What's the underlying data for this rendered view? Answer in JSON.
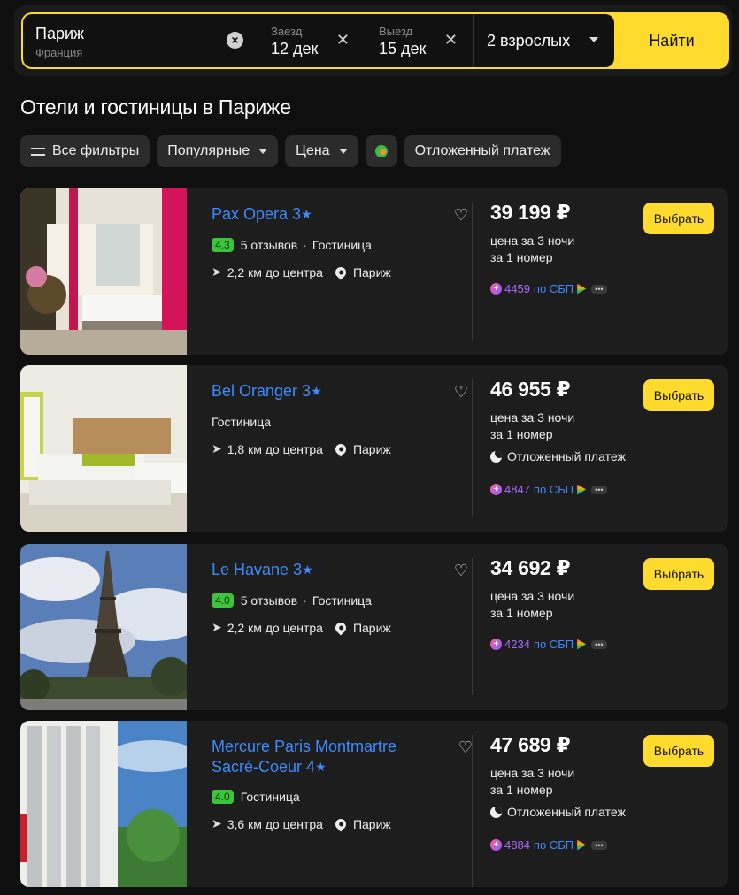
{
  "search": {
    "destination": "Париж",
    "destination_country": "Франция",
    "checkin_label": "Заезд",
    "checkin_value": "12 дек",
    "checkout_label": "Выезд",
    "checkout_value": "15 дек",
    "guests": "2 взрослых",
    "find_label": "Найти"
  },
  "page_title": "Отели и гостиницы в Париже",
  "filters": {
    "all_filters": "Все фильтры",
    "popular": "Популярные",
    "price": "Цена",
    "deferred": "Отложенный платеж"
  },
  "hotels": [
    {
      "name": "Pax Opera 3",
      "rating": "4.3",
      "reviews": "5 отзывов",
      "type": "Гостиница",
      "distance": "2,2 км до центра",
      "city": "Париж",
      "price": "39 199 ₽",
      "price_note_1": "цена за 3 ночи",
      "price_note_2": "за 1 номер",
      "deferred": "",
      "cashback": "4459",
      "cashback_suffix": "по СБП",
      "select": "Выбрать"
    },
    {
      "name": "Bel Oranger 3",
      "rating": "",
      "reviews": "",
      "type": "Гостиница",
      "distance": "1,8 км до центра",
      "city": "Париж",
      "price": "46 955 ₽",
      "price_note_1": "цена за 3 ночи",
      "price_note_2": "за 1 номер",
      "deferred": "Отложенный платеж",
      "cashback": "4847",
      "cashback_suffix": "по СБП",
      "select": "Выбрать"
    },
    {
      "name": "Le Havane 3",
      "rating": "4.0",
      "reviews": "5 отзывов",
      "type": "Гостиница",
      "distance": "2,2 км до центра",
      "city": "Париж",
      "price": "34 692 ₽",
      "price_note_1": "цена за 3 ночи",
      "price_note_2": "за 1 номер",
      "deferred": "",
      "cashback": "4234",
      "cashback_suffix": "по СБП",
      "select": "Выбрать"
    },
    {
      "name": "Mercure Paris Montmartre Sacré-Coeur 4",
      "rating": "4.0",
      "reviews": "",
      "type": "Гостиница",
      "distance": "3,6 км до центра",
      "city": "Париж",
      "price": "47 689 ₽",
      "price_note_1": "цена за 3 ночи",
      "price_note_2": "за 1 номер",
      "deferred": "Отложенный платеж",
      "cashback": "4884",
      "cashback_suffix": "по СБП",
      "select": "Выбрать"
    }
  ],
  "colors": {
    "accent": "#ffdb2e",
    "link": "#3d8bff",
    "rating": "#3ec43c",
    "cashback": "#a86bff"
  }
}
